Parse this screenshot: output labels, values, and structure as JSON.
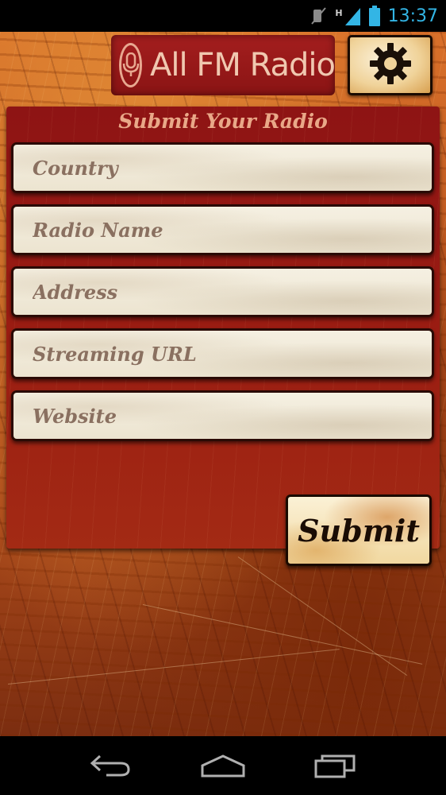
{
  "status_bar": {
    "time": "13:37",
    "network_label": "H",
    "icons": [
      "mute-icon",
      "signal-icon",
      "battery-icon"
    ]
  },
  "header": {
    "app_title": "All FM Radio",
    "logo_icon": "microphone-icon",
    "settings_icon": "gear-icon"
  },
  "form": {
    "title": "Submit Your Radio",
    "fields": [
      {
        "placeholder": "Country",
        "value": ""
      },
      {
        "placeholder": "Radio Name",
        "value": ""
      },
      {
        "placeholder": "Address",
        "value": ""
      },
      {
        "placeholder": "Streaming URL",
        "value": ""
      },
      {
        "placeholder": "Website",
        "value": ""
      }
    ],
    "submit_label": "Submit"
  },
  "nav_bar": {
    "buttons": [
      "back-icon",
      "home-icon",
      "recent-apps-icon"
    ]
  },
  "colors": {
    "status_accent": "#33b5e5",
    "wood_orange": "#c0601f",
    "panel_red": "#8e1414",
    "field_bg": "#f2ecdc",
    "placeholder_text": "#8a7060"
  }
}
